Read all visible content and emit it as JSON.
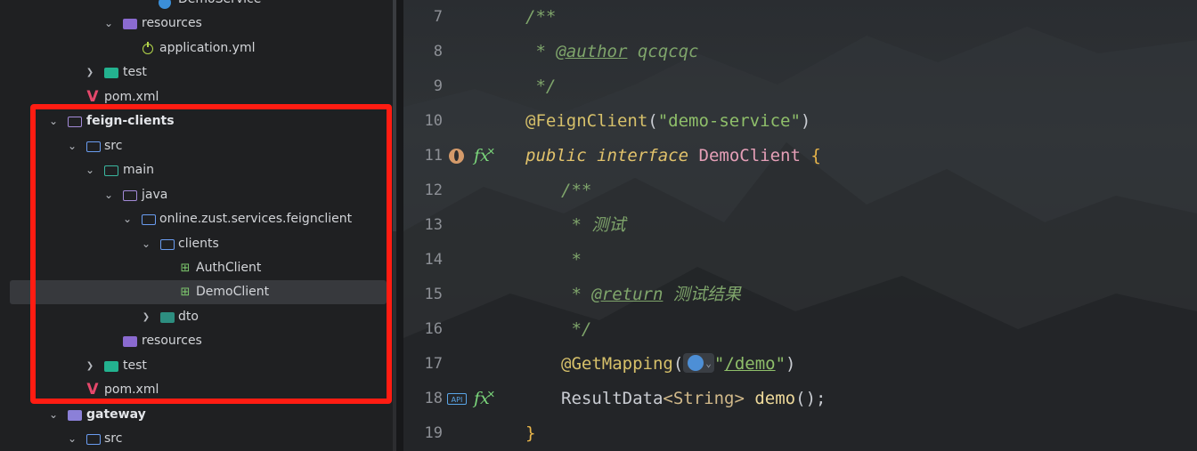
{
  "tree": {
    "items": [
      {
        "label": "DemoService"
      },
      {
        "label": "resources"
      },
      {
        "label": "application.yml"
      },
      {
        "label": "test"
      },
      {
        "label": "pom.xml"
      },
      {
        "label": "feign-clients"
      },
      {
        "label": "src"
      },
      {
        "label": "main"
      },
      {
        "label": "java"
      },
      {
        "label": "online.zust.services.feignclient"
      },
      {
        "label": "clients"
      },
      {
        "label": "AuthClient"
      },
      {
        "label": "DemoClient"
      },
      {
        "label": "dto"
      },
      {
        "label": "resources"
      },
      {
        "label": "test"
      },
      {
        "label": "pom.xml"
      },
      {
        "label": "gateway"
      },
      {
        "label": "src"
      }
    ],
    "selected_item": "DemoClient"
  },
  "editor": {
    "line_numbers": [
      "7",
      "8",
      "9",
      "10",
      "11",
      "12",
      "13",
      "14",
      "15",
      "16",
      "17",
      "18",
      "19"
    ],
    "tokens": {
      "l7": "/**",
      "l8_a": " * ",
      "l8_tag": "@author",
      "l8_b": " qcqcqc",
      "l9": " */",
      "l10_ann": "@FeignClient",
      "l10_p1": "(",
      "l10_str": "\"demo-service\"",
      "l10_p2": ")",
      "l11_kw1": "public",
      "l11_kw2": "interface",
      "l11_cls": "DemoClient",
      "l11_brace": "{",
      "l12": "/**",
      "l13": " * 测试",
      "l14": " *",
      "l15_a": " * ",
      "l15_tag": "@return",
      "l15_b": " 测试结果",
      "l16": " */",
      "l17_ann": "@GetMapping",
      "l17_p1": "(",
      "l17_q1": "\"",
      "l17_path": "/demo",
      "l17_q2": "\"",
      "l17_p2": ")",
      "l18_type": "ResultData",
      "l18_gen": "<String>",
      "l18_meth": "demo",
      "l18_end": "();",
      "l19": "}"
    },
    "gutter": {
      "fx_label": "fx",
      "api_label": "API"
    }
  },
  "colors": {
    "highlight_box": "#ff1c12",
    "selection": "#37393d"
  }
}
